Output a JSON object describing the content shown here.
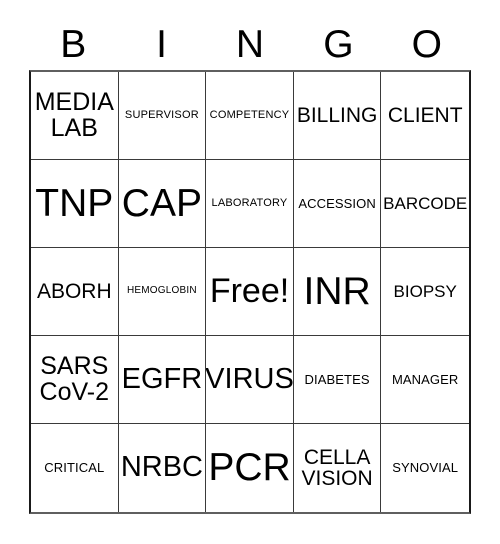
{
  "card": {
    "title": "BINGO",
    "header_letters": [
      "B",
      "I",
      "N",
      "G",
      "O"
    ],
    "free_space_label": "Free!",
    "colors": {
      "text": "#000000",
      "grid_line": "#3a3a3a",
      "outer_border": "#1a1a1a",
      "background": "#ffffff"
    },
    "rows": [
      [
        {
          "label": "MEDIA\nLAB",
          "size": "sz-xl"
        },
        {
          "label": "SUPERVISOR",
          "size": "sz-xs"
        },
        {
          "label": "COMPETENCY",
          "size": "sz-xs"
        },
        {
          "label": "BILLING",
          "size": "sz-l"
        },
        {
          "label": "CLIENT",
          "size": "sz-l"
        }
      ],
      [
        {
          "label": "TNP",
          "size": "sz-4xl"
        },
        {
          "label": "CAP",
          "size": "sz-4xl"
        },
        {
          "label": "LABORATORY",
          "size": "sz-xs"
        },
        {
          "label": "ACCESSION",
          "size": "sz-s"
        },
        {
          "label": "BARCODE",
          "size": "sz-m"
        }
      ],
      [
        {
          "label": "ABORH",
          "size": "sz-l"
        },
        {
          "label": "HEMOGLOBIN",
          "size": "sz-xxs"
        },
        {
          "label": "Free!",
          "size": "sz-3xl"
        },
        {
          "label": "INR",
          "size": "sz-4xl"
        },
        {
          "label": "BIOPSY",
          "size": "sz-m"
        }
      ],
      [
        {
          "label": "SARS\nCoV-2",
          "size": "sz-xl"
        },
        {
          "label": "EGFR",
          "size": "sz-xxl"
        },
        {
          "label": "VIRUS",
          "size": "sz-xxl"
        },
        {
          "label": "DIABETES",
          "size": "sz-s"
        },
        {
          "label": "MANAGER",
          "size": "sz-s"
        }
      ],
      [
        {
          "label": "CRITICAL",
          "size": "sz-s"
        },
        {
          "label": "NRBC",
          "size": "sz-xxl"
        },
        {
          "label": "PCR",
          "size": "sz-4xl"
        },
        {
          "label": "CELLA\nVISION",
          "size": "sz-l"
        },
        {
          "label": "SYNOVIAL",
          "size": "sz-s"
        }
      ]
    ]
  }
}
